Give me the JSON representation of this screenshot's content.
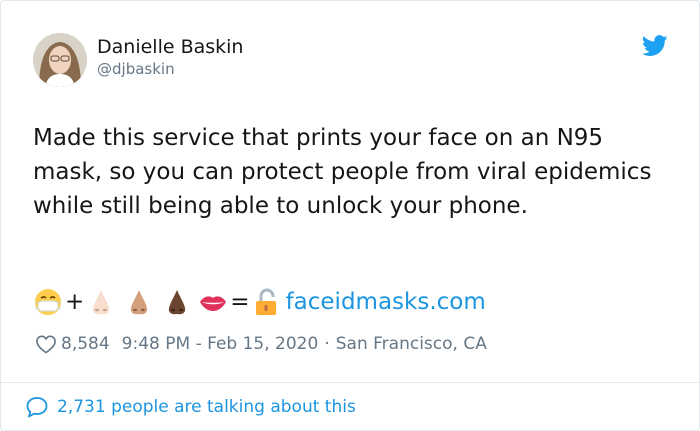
{
  "author": {
    "name": "Danielle Baskin",
    "handle": "@djbaskin"
  },
  "tweet": {
    "text": "Made this service that prints your face on an N95 mask, so you can protect people from viral epidemics while still being able to unlock your phone."
  },
  "equation": {
    "plus": "+",
    "equals": "=",
    "link_text": "faceidmasks.com",
    "icons": [
      "mask-face-emoji",
      "nose-light-emoji",
      "nose-medium-emoji",
      "nose-dark-emoji",
      "lips-emoji",
      "unlocked-emoji"
    ]
  },
  "meta": {
    "likes": "8,584",
    "timestamp": "9:48 PM - Feb 15, 2020",
    "separator": "·",
    "location": "San Francisco, CA"
  },
  "footer": {
    "talking_text": "2,731 people are talking about this"
  },
  "colors": {
    "link": "#1b95e0",
    "text": "#14171a",
    "muted": "#657786",
    "border": "#e1e8ed"
  }
}
